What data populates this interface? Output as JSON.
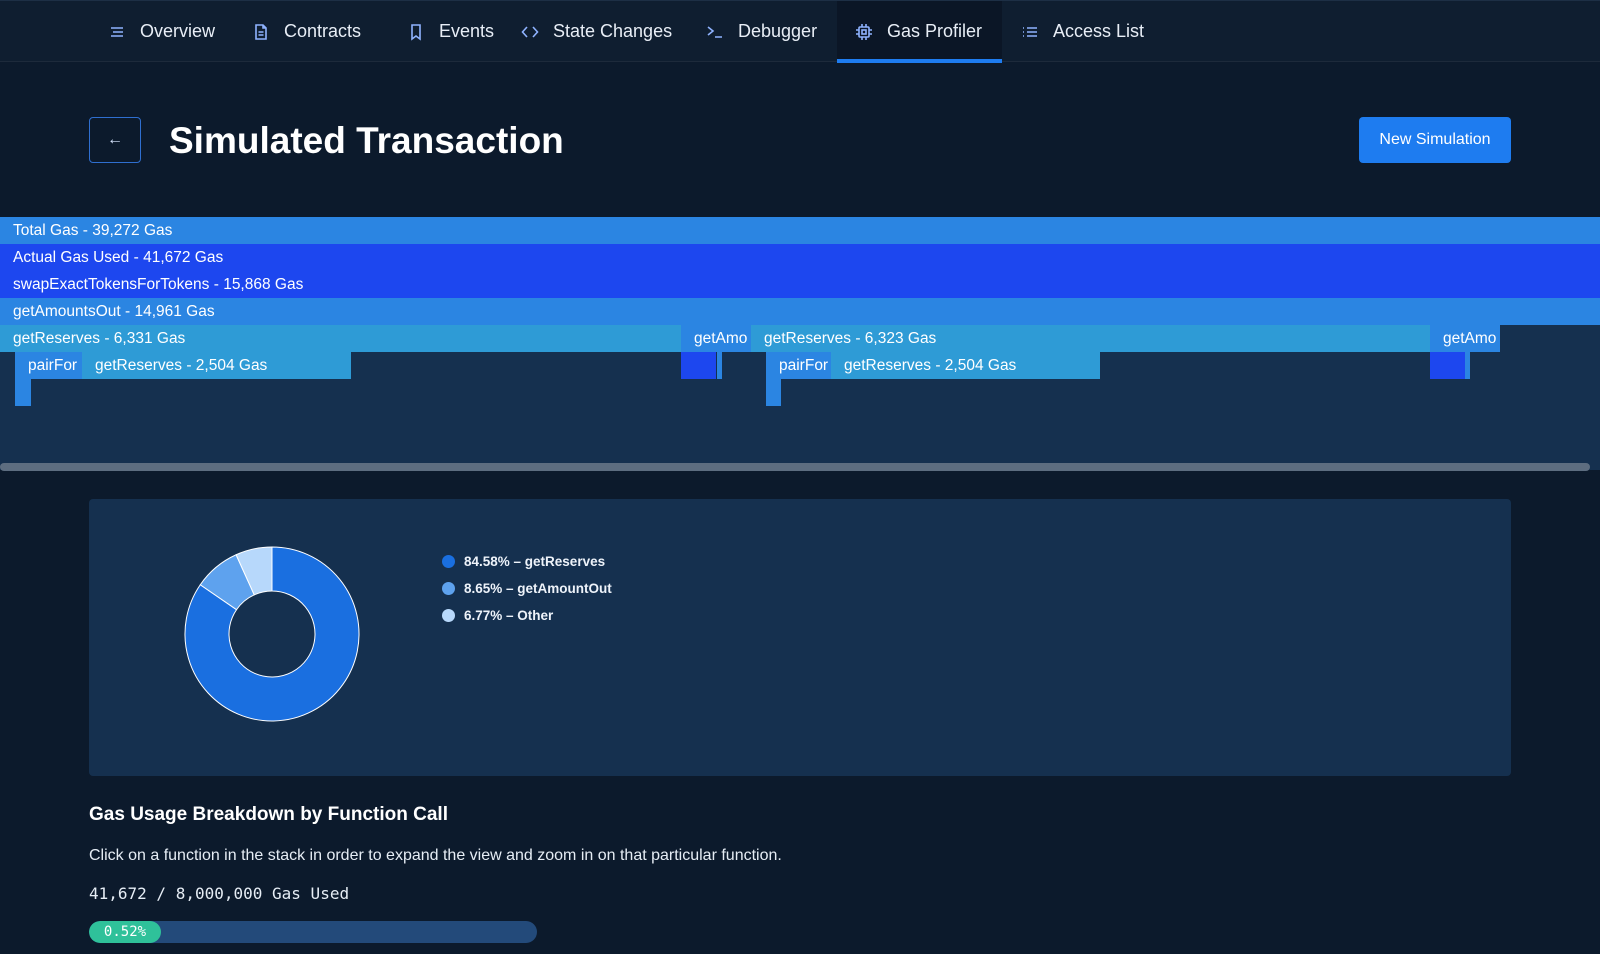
{
  "nav": {
    "tabs": [
      {
        "label": "Overview",
        "icon": "menu-lines-icon"
      },
      {
        "label": "Contracts",
        "icon": "document-icon"
      },
      {
        "label": "Events",
        "icon": "bookmark-icon"
      },
      {
        "label": "State Changes",
        "icon": "code-brackets-icon"
      },
      {
        "label": "Debugger",
        "icon": "terminal-prompt-icon"
      },
      {
        "label": "Gas Profiler",
        "icon": "chip-icon",
        "active": true
      },
      {
        "label": "Access List",
        "icon": "list-icon"
      }
    ]
  },
  "header": {
    "back_icon": "←",
    "title": "Simulated Transaction",
    "new_simulation_label": "New Simulation"
  },
  "flame": {
    "rows": [
      {
        "label": "Total Gas - 39,272 Gas"
      },
      {
        "label": "Actual Gas Used - 41,672 Gas"
      },
      {
        "label": "swapExactTokensForTokens - 15,868 Gas"
      },
      {
        "label": "getAmountsOut - 14,961 Gas"
      }
    ],
    "row5": {
      "a": "getReserves - 6,331 Gas",
      "b": "getAmo",
      "c": "getReserves - 6,323 Gas",
      "d": "getAmo"
    },
    "row6": {
      "a": "pairFor",
      "b": "getReserves - 2,504 Gas",
      "c": "pairFor",
      "d": "getReserves - 2,504 Gas"
    }
  },
  "pie": {
    "slices": [
      {
        "label": "84.58% – getReserves",
        "value": 84.58,
        "color": "#1a6fe0"
      },
      {
        "label": "8.65% – getAmountOut",
        "value": 8.65,
        "color": "#5ea2ee"
      },
      {
        "label": "6.77% – Other",
        "value": 6.77,
        "color": "#b7d8fb"
      }
    ]
  },
  "breakdown": {
    "title": "Gas Usage Breakdown by Function Call",
    "description": "Click on a function in the stack in order to expand the view and zoom in on that particular function.",
    "gas_used_text": "41,672 / 8,000,000 Gas Used",
    "progress_label": "0.52%",
    "progress_value": 0.52
  }
}
